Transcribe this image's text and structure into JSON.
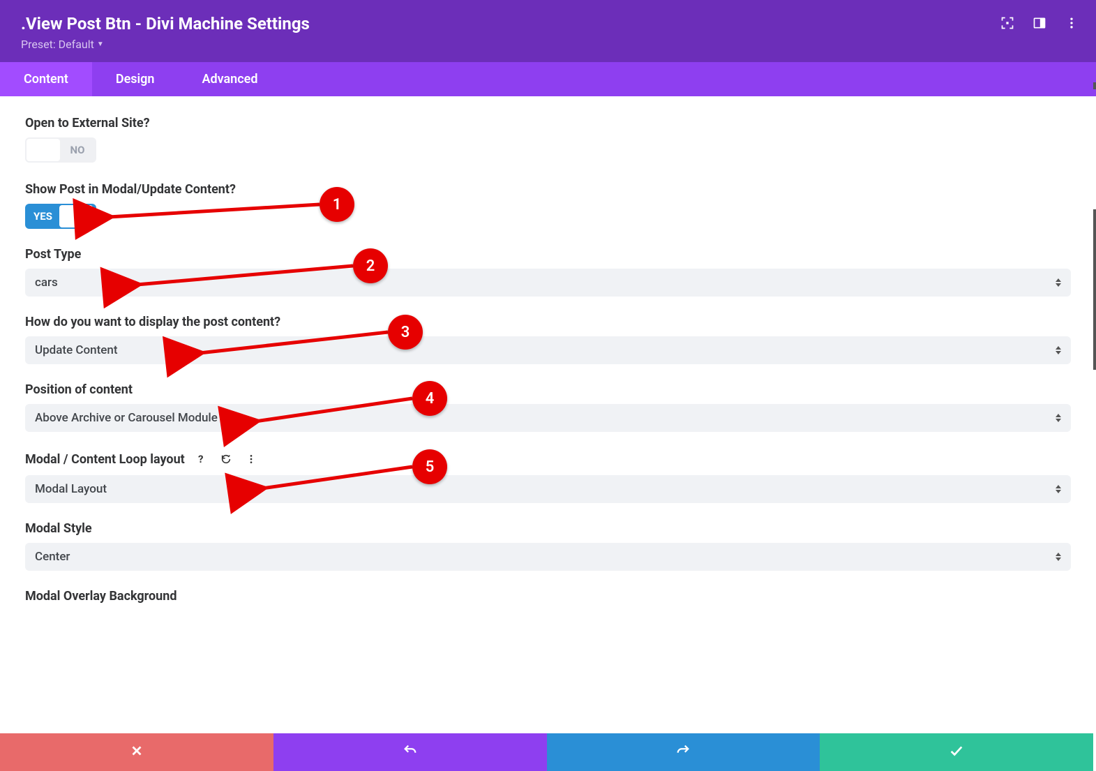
{
  "header": {
    "title": ".View Post Btn - Divi Machine Settings",
    "preset_label": "Preset: Default"
  },
  "tabs": {
    "content": "Content",
    "design": "Design",
    "advanced": "Advanced"
  },
  "fields": {
    "open_external": {
      "label": "Open to External Site?",
      "value": "NO"
    },
    "show_modal": {
      "label": "Show Post in Modal/Update Content?",
      "value": "YES"
    },
    "post_type": {
      "label": "Post Type",
      "value": "cars"
    },
    "display_how": {
      "label": "How do you want to display the post content?",
      "value": "Update Content"
    },
    "position": {
      "label": "Position of content",
      "value": "Above Archive or Carousel Module"
    },
    "loop_layout": {
      "label": "Modal / Content Loop layout",
      "value": "Modal Layout"
    },
    "modal_style": {
      "label": "Modal Style",
      "value": "Center"
    },
    "overlay_bg": {
      "label": "Modal Overlay Background"
    }
  },
  "callouts": {
    "c1": "1",
    "c2": "2",
    "c3": "3",
    "c4": "4",
    "c5": "5"
  }
}
